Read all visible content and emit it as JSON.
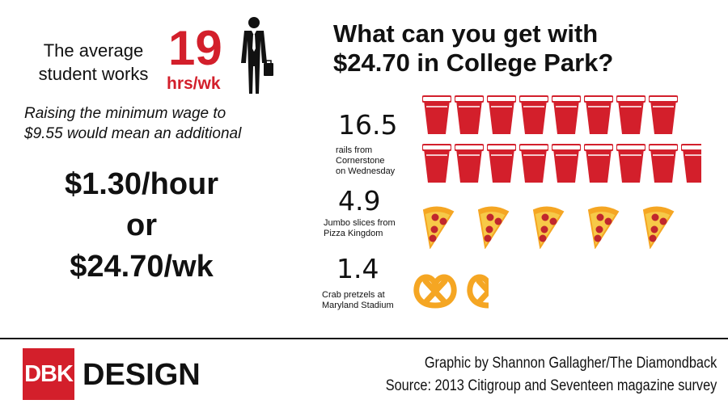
{
  "intro": {
    "line1": "The average",
    "line2": "student works",
    "hours_value": "19",
    "hours_unit": "hrs/wk"
  },
  "raise": {
    "line1": "Raising the minimum wage to",
    "line2": "$9.55 would mean an additional"
  },
  "amount": {
    "hourly": "$1.30/hour",
    "or": "or",
    "weekly": "$24.70/wk"
  },
  "title": {
    "line1": "What can you get with",
    "line2": "$24.70 in College Park?"
  },
  "items": [
    {
      "value": "16.5",
      "label_lines": [
        "rails from",
        "Cornerstone",
        "on Wednesday"
      ],
      "icon": "red-cup-icon",
      "count": 16.5
    },
    {
      "value": "4.9",
      "label_lines": [
        "Jumbo slices from",
        "Pizza Kingdom"
      ],
      "icon": "pizza-slice-icon",
      "count": 4.9
    },
    {
      "value": "1.4",
      "label_lines": [
        "Crab pretzels at",
        "Maryland Stadium"
      ],
      "icon": "pretzel-icon",
      "count": 1.4
    }
  ],
  "footer": {
    "logo": "DBK",
    "section": "DESIGN",
    "credit": "Graphic by Shannon Gallagher/The Diamondback",
    "source": "Source: 2013 Citigroup and Seventeen magazine survey"
  },
  "colors": {
    "accent": "#d31f2b",
    "cup": "#d31f2b",
    "pizza_crust": "#f5a623",
    "pizza_cheese": "#f7c948",
    "pepperoni": "#c1272d",
    "pretzel": "#f5a623"
  }
}
